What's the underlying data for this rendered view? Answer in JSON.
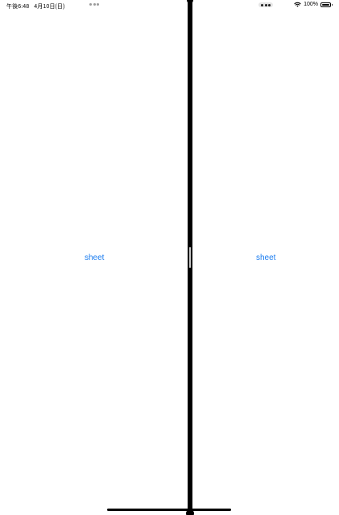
{
  "status_bar": {
    "time": "午後6:48",
    "date": "4月10日(日)",
    "battery_percent": "100%",
    "wifi_icon": "wifi-icon",
    "battery_icon": "battery-icon",
    "battery_level": 1.0
  },
  "left_pane": {
    "multitask_icon": "more-dots-icon",
    "sheet_label": "sheet"
  },
  "right_pane": {
    "multitask_icon": "more-dots-icon",
    "sheet_label": "sheet"
  },
  "colors": {
    "link": "#1a7cf0",
    "divider": "#000000",
    "background": "#ffffff"
  }
}
